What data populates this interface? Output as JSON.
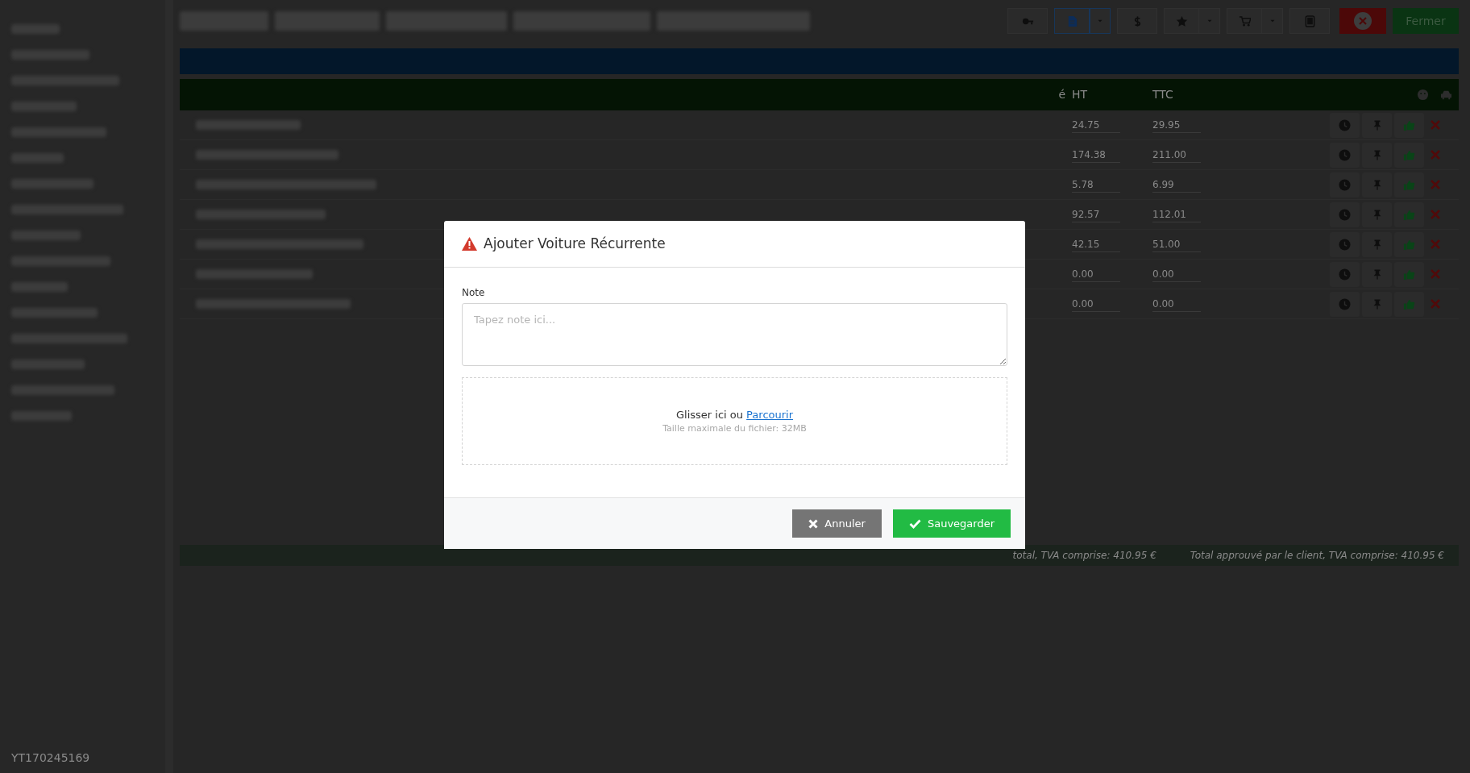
{
  "sidebar": {
    "footer_text": "YT170245169"
  },
  "toolbar": {
    "buttons": [
      {
        "kind": "plain",
        "selected": false
      },
      {
        "kind": "split",
        "selected": true
      },
      {
        "kind": "plain",
        "selected": false
      },
      {
        "kind": "split",
        "selected": false
      },
      {
        "kind": "split",
        "selected": false
      },
      {
        "kind": "plain",
        "selected": false
      }
    ],
    "close_label": "Fermer"
  },
  "table": {
    "columns": [
      "é",
      "HT",
      "TTC"
    ],
    "rows": [
      {
        "ht": "24.75",
        "ttc": "29.95"
      },
      {
        "ht": "174.38",
        "ttc": "211.00"
      },
      {
        "ht": "5.78",
        "ttc": "6.99"
      },
      {
        "ht": "92.57",
        "ttc": "112.01"
      },
      {
        "ht": "42.15",
        "ttc": "51.00"
      },
      {
        "ht": "0.00",
        "ttc": "0.00"
      },
      {
        "ht": "0.00",
        "ttc": "0.00"
      }
    ]
  },
  "totals": [
    "total, TVA comprise: 410.95 €",
    "Total approuvé par le client, TVA comprise: 410.95 €"
  ],
  "modal": {
    "title": "Ajouter Voiture Récurrente",
    "note_label": "Note",
    "note_placeholder": "Tapez note ici...",
    "dropzone": {
      "text": "Glisser ici ou",
      "link": "Parcourir",
      "hint": "Taille maximale du fichier: 32MB"
    },
    "buttons": [
      {
        "kind": "cancel",
        "label": "Annuler"
      },
      {
        "kind": "save",
        "label": "Sauvegarder"
      }
    ]
  }
}
